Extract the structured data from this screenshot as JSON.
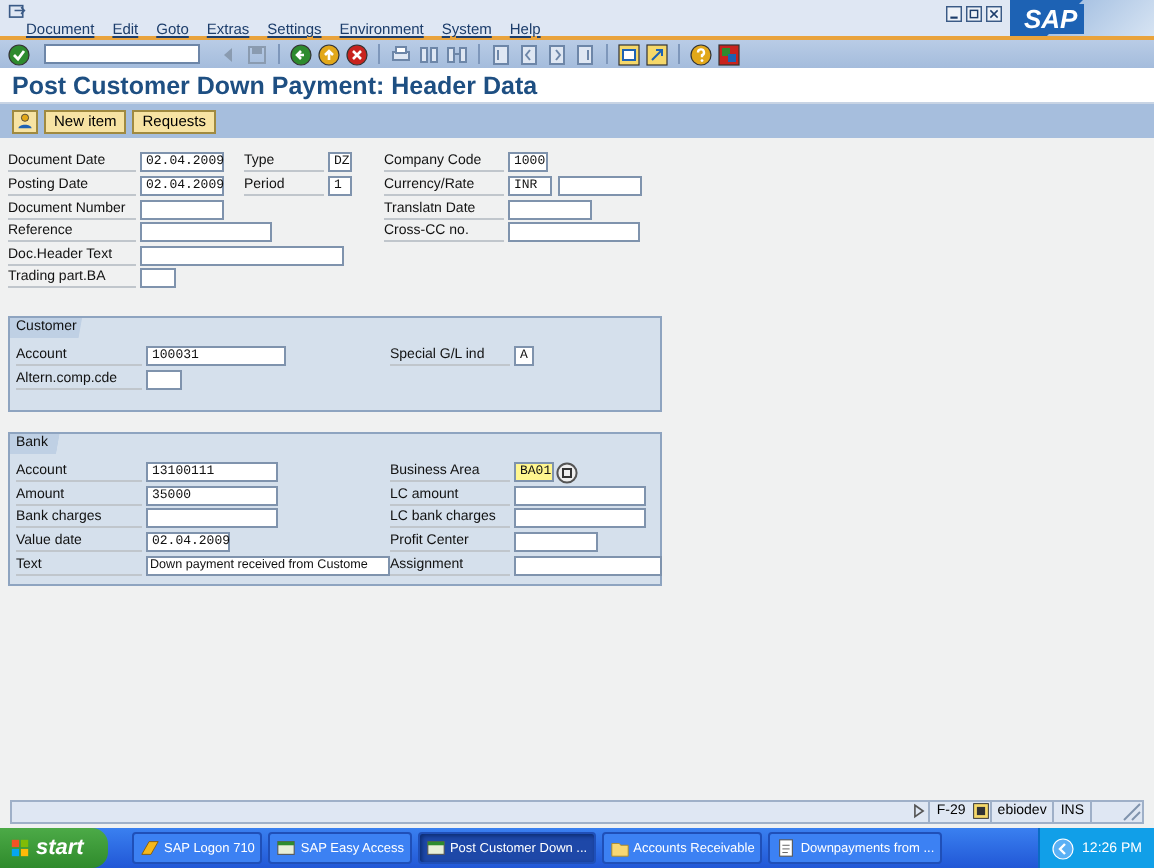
{
  "window": {
    "logo": "SAP"
  },
  "menu": [
    "Document",
    "Edit",
    "Goto",
    "Extras",
    "Settings",
    "Environment",
    "System",
    "Help"
  ],
  "title": "Post Customer Down Payment: Header Data",
  "app_toolbar": [
    "New item",
    "Requests"
  ],
  "header_fields": [
    {
      "label": "Document Date",
      "value": "02.04.2009"
    },
    {
      "label": "Type",
      "value": "DZ"
    },
    {
      "label": "Company Code",
      "value": "1000"
    },
    {
      "label": "Posting Date",
      "value": "02.04.2009"
    },
    {
      "label": "Period",
      "value": "1"
    },
    {
      "label": "Currency/Rate",
      "value": "INR"
    },
    {
      "label": "Document Number"
    },
    {
      "label": "Translatn Date"
    },
    {
      "label": "Reference"
    },
    {
      "label": "Cross-CC no."
    },
    {
      "label": "Doc.Header Text"
    },
    {
      "label": "Trading part.BA"
    }
  ],
  "customer": {
    "title": "Customer",
    "fields": [
      {
        "label": "Account",
        "value": "100031"
      },
      {
        "label": "Special G/L ind",
        "value": "A"
      },
      {
        "label": "Altern.comp.cde"
      }
    ]
  },
  "bank": {
    "title": "Bank",
    "fields": [
      {
        "label": "Account",
        "value": "13100111",
        "highlighted": false
      },
      {
        "label": "Business Area",
        "value": "BA01",
        "highlighted": true
      },
      {
        "label": "Amount",
        "value": "35000",
        "highlighted": false
      },
      {
        "label": "LC amount",
        "highlighted": false
      },
      {
        "label": "Bank charges",
        "highlighted": false
      },
      {
        "label": "LC bank charges",
        "highlighted": false
      },
      {
        "label": "Value date",
        "value": "02.04.2009",
        "highlighted": false
      },
      {
        "label": "Profit Center",
        "highlighted": false
      },
      {
        "label": "Text",
        "value": "Down payment received from Custome",
        "highlighted": false
      },
      {
        "label": "Assignment",
        "highlighted": false
      }
    ]
  },
  "status_bar": {
    "transaction": "F-29",
    "server": "ebiodev",
    "mode": "INS"
  },
  "taskbar": {
    "start": "start",
    "items": [
      {
        "label": "SAP Logon 710",
        "selected": false
      },
      {
        "label": "SAP Easy Access",
        "selected": false
      },
      {
        "label": "Post Customer Down ...",
        "selected": true
      },
      {
        "label": "Accounts Receivable",
        "selected": false
      },
      {
        "label": "Downpayments from ...",
        "selected": false
      }
    ],
    "clock": "12:26 PM"
  }
}
